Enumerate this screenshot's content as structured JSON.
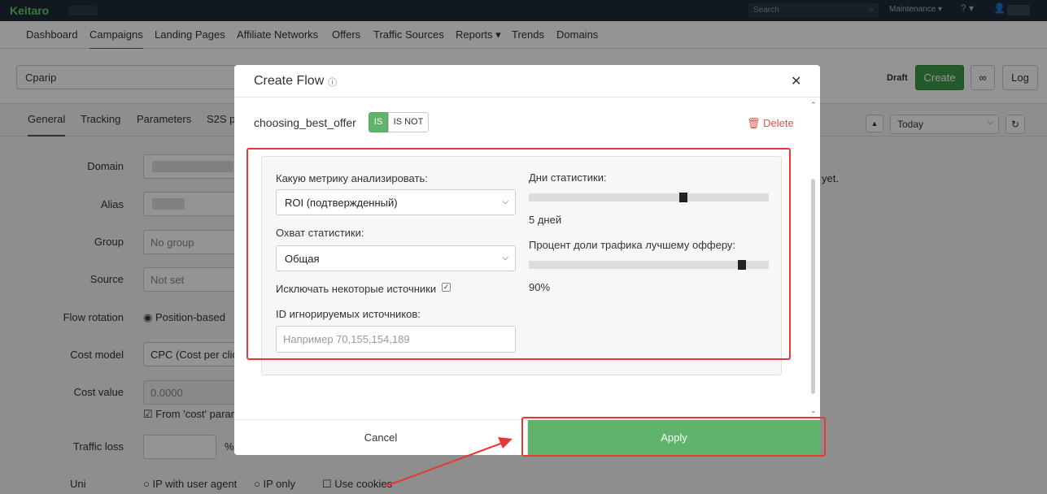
{
  "topbar": {
    "logo": "Keitaro",
    "search_placeholder": "Search",
    "maintenance": "Maintenance ▾",
    "help": "? ▾",
    "user_icon": "user-icon"
  },
  "nav": {
    "items": [
      "Dashboard",
      "Campaigns",
      "Landing Pages",
      "Affiliate Networks",
      "Offers",
      "Traffic Sources",
      "Reports ▾",
      "Trends",
      "Domains"
    ],
    "active": "Campaigns"
  },
  "campaign": {
    "name": "Cparip",
    "status": "Draft",
    "create_label": "Create",
    "log_label": "Log"
  },
  "subtabs": {
    "items": [
      "General",
      "Tracking",
      "Parameters",
      "S2S p"
    ],
    "active": "General",
    "period": "Today"
  },
  "form": {
    "domain_label": "Domain",
    "alias_label": "Alias",
    "group_label": "Group",
    "group_value": "No group",
    "source_label": "Source",
    "source_value": "Not set",
    "flow_rotation_label": "Flow rotation",
    "flow_rotation_value": "Position-based",
    "cost_model_label": "Cost model",
    "cost_model_value": "CPC (Cost per clic",
    "cost_value_label": "Cost value",
    "cost_value_value": "0.0000",
    "cost_param": "From 'cost' param",
    "traffic_loss_label": "Traffic loss",
    "traffic_loss_unit": "%",
    "uniqueness_label": "Uni",
    "uniqueness_opt1": "IP with user agent",
    "uniqueness_opt2": "IP only",
    "uniqueness_opt3": "Use cookies",
    "no_stats": "yet."
  },
  "modal": {
    "title": "Create Flow",
    "filter": {
      "name": "choosing_best_offer",
      "is_label": "IS",
      "is_not_label": "IS NOT",
      "delete_label": "Delete"
    },
    "panel": {
      "metric_label": "Какую метрику анализировать:",
      "metric_value": "ROI (подтвержденный)",
      "coverage_label": "Охват статистики:",
      "coverage_value": "Общая",
      "exclude_label": "Исключать некоторые источники",
      "exclude_checked": true,
      "ignored_ids_label": "ID игнорируемых источников:",
      "ignored_ids_placeholder": "Например 70,155,154,189",
      "days_label": "Дни статистики:",
      "days_value": "5 дней",
      "days_fraction": 0.65,
      "percent_label": "Процент доли трафика лучшему офферу:",
      "percent_value": "90%",
      "percent_fraction": 0.9
    },
    "footer": {
      "cancel_label": "Cancel",
      "apply_label": "Apply"
    }
  },
  "colors": {
    "accent_green": "#5fb36a",
    "annotation_red": "#e53935",
    "delete_red": "#d9534f"
  }
}
